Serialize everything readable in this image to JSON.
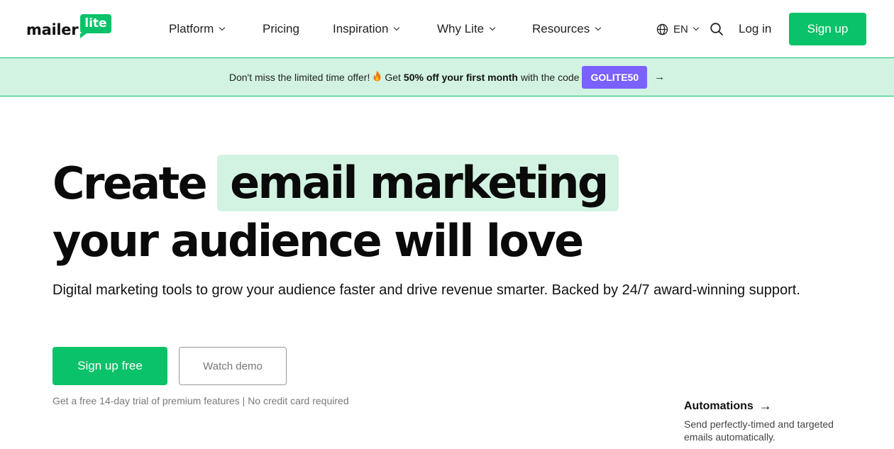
{
  "header": {
    "logo": {
      "word": "mailer",
      "badge": "lite"
    },
    "nav": [
      {
        "label": "Platform",
        "has_dropdown": true
      },
      {
        "label": "Pricing",
        "has_dropdown": false
      },
      {
        "label": "Inspiration",
        "has_dropdown": true
      },
      {
        "label": "Why Lite",
        "has_dropdown": true
      },
      {
        "label": "Resources",
        "has_dropdown": true
      }
    ],
    "language": "EN",
    "login_label": "Log in",
    "signup_label": "Sign up"
  },
  "promo": {
    "text_before": "Don't miss the limited time offer!",
    "text_get": "Get",
    "highlight": "50% off your first month",
    "text_after": "with the code",
    "code": "GOLITE50"
  },
  "hero": {
    "title_plain": "Create",
    "title_highlight": "email marketing",
    "title_line2": "your audience will love",
    "subtitle": "Digital marketing tools to grow your audience faster and drive revenue smarter. Backed by 24/7 award-winning support.",
    "primary_cta": "Sign up free",
    "secondary_cta": "Watch demo",
    "note": "Get a free 14-day trial of premium features | No credit card required"
  },
  "feature": {
    "title": "Automations",
    "description": "Send perfectly-timed and targeted emails automatically."
  },
  "colors": {
    "brand_green": "#09c269",
    "banner_green": "#d2f3e1",
    "code_purple": "#7b61ff"
  }
}
